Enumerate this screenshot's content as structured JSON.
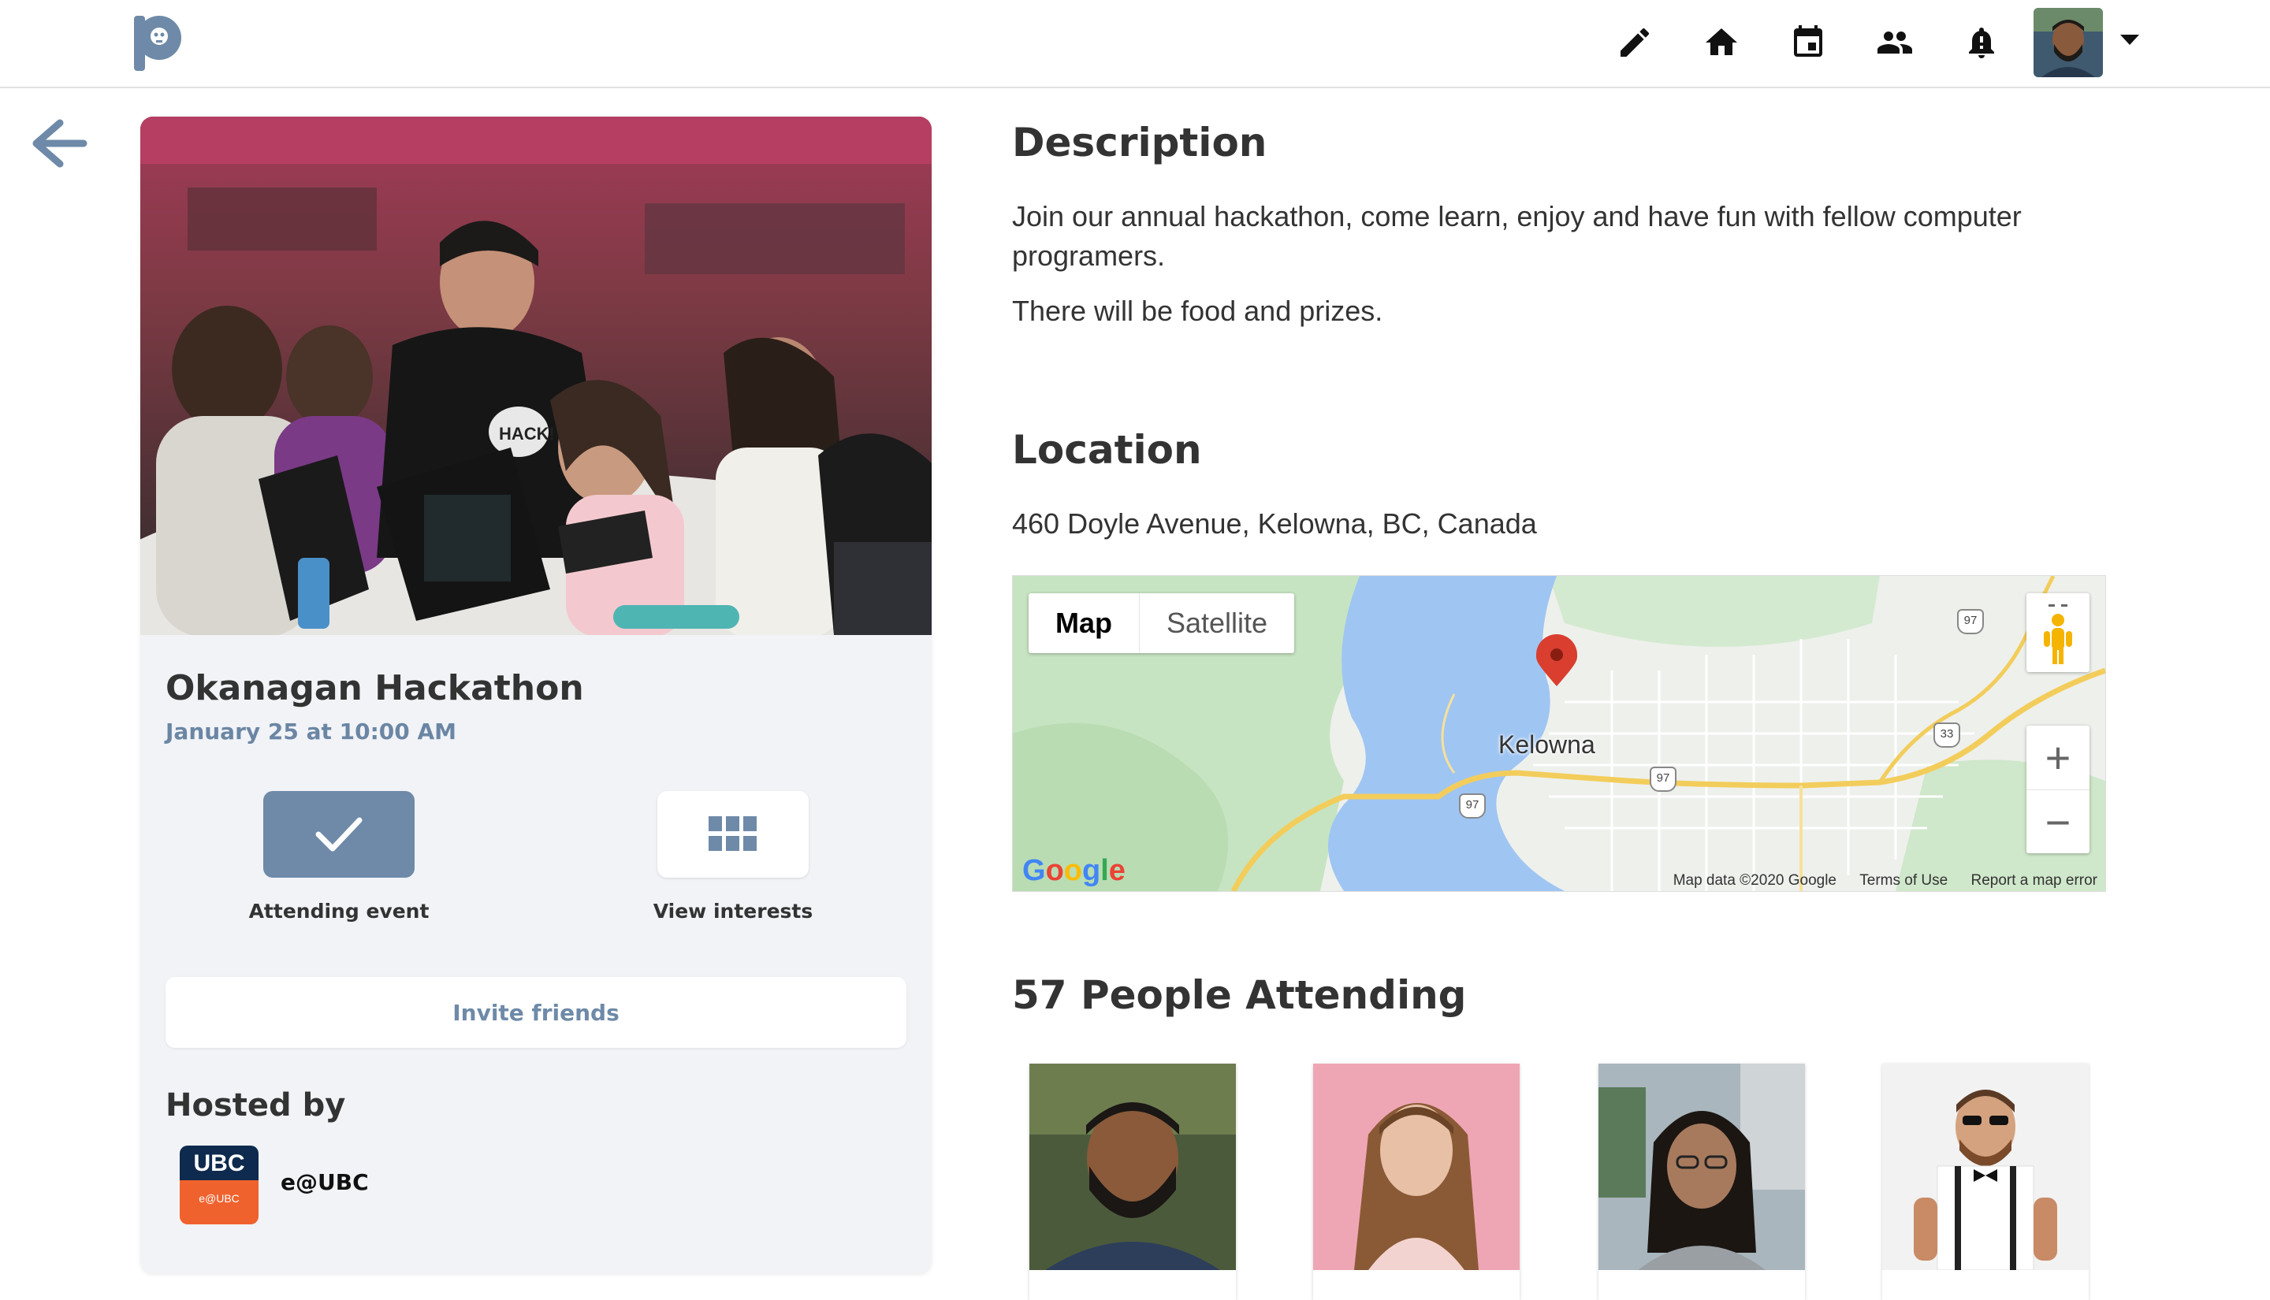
{
  "nav": {
    "icons": [
      "edit-icon",
      "home-icon",
      "calendar-icon",
      "people-icon",
      "notification-icon"
    ],
    "avatar": "user-avatar"
  },
  "event": {
    "title": "Okanagan Hackathon",
    "date": "January 25 at 10:00 AM",
    "hero_badge": "HACK!",
    "attending_label": "Attending event",
    "interests_label": "View interests",
    "invite_label": "Invite friends",
    "hosted_by_title": "Hosted by",
    "host": {
      "name": "e@UBC",
      "logo_top": "UBC",
      "logo_bottom": "e@UBC"
    }
  },
  "description": {
    "title": "Description",
    "line1": "Join our annual hackathon, come learn, enjoy and have fun with fellow computer",
    "line2": "programers.",
    "line3": "There will be food and prizes."
  },
  "location": {
    "title": "Location",
    "address": "460 Doyle Avenue, Kelowna, BC, Canada",
    "map": {
      "tab_map": "Map",
      "tab_satellite": "Satellite",
      "city": "Kelowna",
      "zoom_in": "+",
      "zoom_out": "−",
      "attribution": "Map data ©2020 Google",
      "terms": "Terms of Use",
      "report": "Report a map error",
      "highway_97": "97",
      "highway_33": "33",
      "colors": {
        "water": "#9fc5f2",
        "land": "#eef0ec",
        "park": "#c7e4c2",
        "road": "#f3cd5b"
      }
    }
  },
  "attending": {
    "title": "57 People Attending",
    "people": [
      "attendee-1",
      "attendee-2",
      "attendee-3",
      "attendee-4"
    ]
  },
  "theme": {
    "accent": "#6e8aa8",
    "card_bg": "#f1f3f7"
  }
}
